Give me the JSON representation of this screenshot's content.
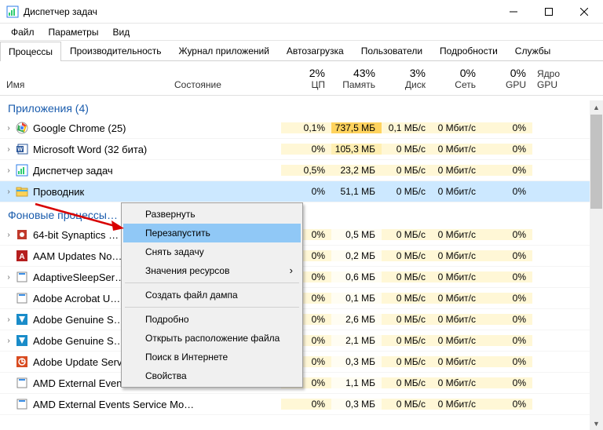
{
  "window": {
    "title": "Диспетчер задач"
  },
  "menu": {
    "file": "Файл",
    "options": "Параметры",
    "view": "Вид"
  },
  "tabs": {
    "items": [
      {
        "label": "Процессы",
        "active": true
      },
      {
        "label": "Производительность"
      },
      {
        "label": "Журнал приложений"
      },
      {
        "label": "Автозагрузка"
      },
      {
        "label": "Пользователи"
      },
      {
        "label": "Подробности"
      },
      {
        "label": "Службы"
      }
    ]
  },
  "columns": {
    "name": "Имя",
    "state": "Состояние",
    "metrics": [
      {
        "pct": "2%",
        "label": "ЦП"
      },
      {
        "pct": "43%",
        "label": "Память"
      },
      {
        "pct": "3%",
        "label": "Диск"
      },
      {
        "pct": "0%",
        "label": "Сеть"
      },
      {
        "pct": "0%",
        "label": "GPU"
      }
    ],
    "gpu_engine": "Ядро GPU"
  },
  "groups": {
    "apps": "Приложения (4)",
    "bg": "Фоновые процессы…"
  },
  "rows": [
    {
      "icon": "chrome",
      "name": "Google Chrome (25)",
      "exp": true,
      "cells": [
        "0,1%",
        "737,5 МБ",
        "0,1 МБ/с",
        "0 Мбит/с",
        "0%"
      ],
      "heat": [
        1,
        4,
        1,
        1,
        1
      ],
      "sel": false
    },
    {
      "icon": "word",
      "name": "Microsoft Word (32 бита)",
      "exp": true,
      "cells": [
        "0%",
        "105,3 МБ",
        "0 МБ/с",
        "0 Мбит/с",
        "0%"
      ],
      "heat": [
        1,
        2,
        1,
        1,
        1
      ],
      "sel": false
    },
    {
      "icon": "tm",
      "name": "Диспетчер задач",
      "exp": true,
      "cells": [
        "0,5%",
        "23,2 МБ",
        "0 МБ/с",
        "0 Мбит/с",
        "0%"
      ],
      "heat": [
        1,
        1,
        1,
        1,
        1
      ],
      "sel": false
    },
    {
      "icon": "explorer",
      "name": "Проводник",
      "exp": true,
      "cells": [
        "0%",
        "51,1 МБ",
        "0 МБ/с",
        "0 Мбит/с",
        "0%"
      ],
      "heat": [
        0,
        0,
        0,
        0,
        0
      ],
      "sel": true
    }
  ],
  "bg_rows": [
    {
      "icon": "syn",
      "name": "64-bit Synaptics …",
      "exp": true,
      "cells": [
        "0%",
        "0,5 МБ",
        "0 МБ/с",
        "0 Мбит/с",
        "0%"
      ],
      "heat": [
        1,
        0,
        1,
        1,
        1
      ]
    },
    {
      "icon": "adobe-a",
      "name": "AAM Updates No…",
      "exp": false,
      "cells": [
        "0%",
        "0,2 МБ",
        "0 МБ/с",
        "0 Мбит/с",
        "0%"
      ],
      "heat": [
        1,
        0,
        1,
        1,
        1
      ]
    },
    {
      "icon": "generic",
      "name": "AdaptiveSleepSer…",
      "exp": true,
      "cells": [
        "0%",
        "0,6 МБ",
        "0 МБ/с",
        "0 Мбит/с",
        "0%"
      ],
      "heat": [
        1,
        0,
        1,
        1,
        1
      ]
    },
    {
      "icon": "generic",
      "name": "Adobe Acrobat U…",
      "exp": false,
      "cells": [
        "0%",
        "0,1 МБ",
        "0 МБ/с",
        "0 Мбит/с",
        "0%"
      ],
      "heat": [
        1,
        0,
        1,
        1,
        1
      ]
    },
    {
      "icon": "adobe-g",
      "name": "Adobe Genuine S…",
      "exp": true,
      "cells": [
        "0%",
        "2,6 МБ",
        "0 МБ/с",
        "0 Мбит/с",
        "0%"
      ],
      "heat": [
        1,
        0,
        1,
        1,
        1
      ]
    },
    {
      "icon": "adobe-g",
      "name": "Adobe Genuine S…",
      "exp": true,
      "cells": [
        "0%",
        "2,1 МБ",
        "0 МБ/с",
        "0 Мбит/с",
        "0%"
      ],
      "heat": [
        1,
        0,
        1,
        1,
        1
      ]
    },
    {
      "icon": "adobe-u",
      "name": "Adobe Update Service (32 бита)",
      "exp": false,
      "cells": [
        "0%",
        "0,3 МБ",
        "0 МБ/с",
        "0 Мбит/с",
        "0%"
      ],
      "heat": [
        1,
        0,
        1,
        1,
        1
      ]
    },
    {
      "icon": "generic",
      "name": "AMD External Events Client Mo…",
      "exp": false,
      "cells": [
        "0%",
        "1,1 МБ",
        "0 МБ/с",
        "0 Мбит/с",
        "0%"
      ],
      "heat": [
        1,
        0,
        1,
        1,
        1
      ]
    },
    {
      "icon": "generic",
      "name": "AMD External Events Service Mo…",
      "exp": false,
      "cells": [
        "0%",
        "0,3 МБ",
        "0 МБ/с",
        "0 Мбит/с",
        "0%"
      ],
      "heat": [
        1,
        0,
        1,
        1,
        1
      ]
    }
  ],
  "context_menu": {
    "items": [
      {
        "label": "Развернуть",
        "sel": false
      },
      {
        "label": "Перезапустить",
        "sel": true
      },
      {
        "label": "Снять задачу",
        "sel": false
      },
      {
        "label": "Значения ресурсов",
        "sel": false,
        "arrow": true
      },
      {
        "sep": true
      },
      {
        "label": "Создать файл дампа",
        "sel": false
      },
      {
        "sep": true
      },
      {
        "label": "Подробно",
        "sel": false
      },
      {
        "label": "Открыть расположение файла",
        "sel": false
      },
      {
        "label": "Поиск в Интернете",
        "sel": false
      },
      {
        "label": "Свойства",
        "sel": false
      }
    ]
  }
}
